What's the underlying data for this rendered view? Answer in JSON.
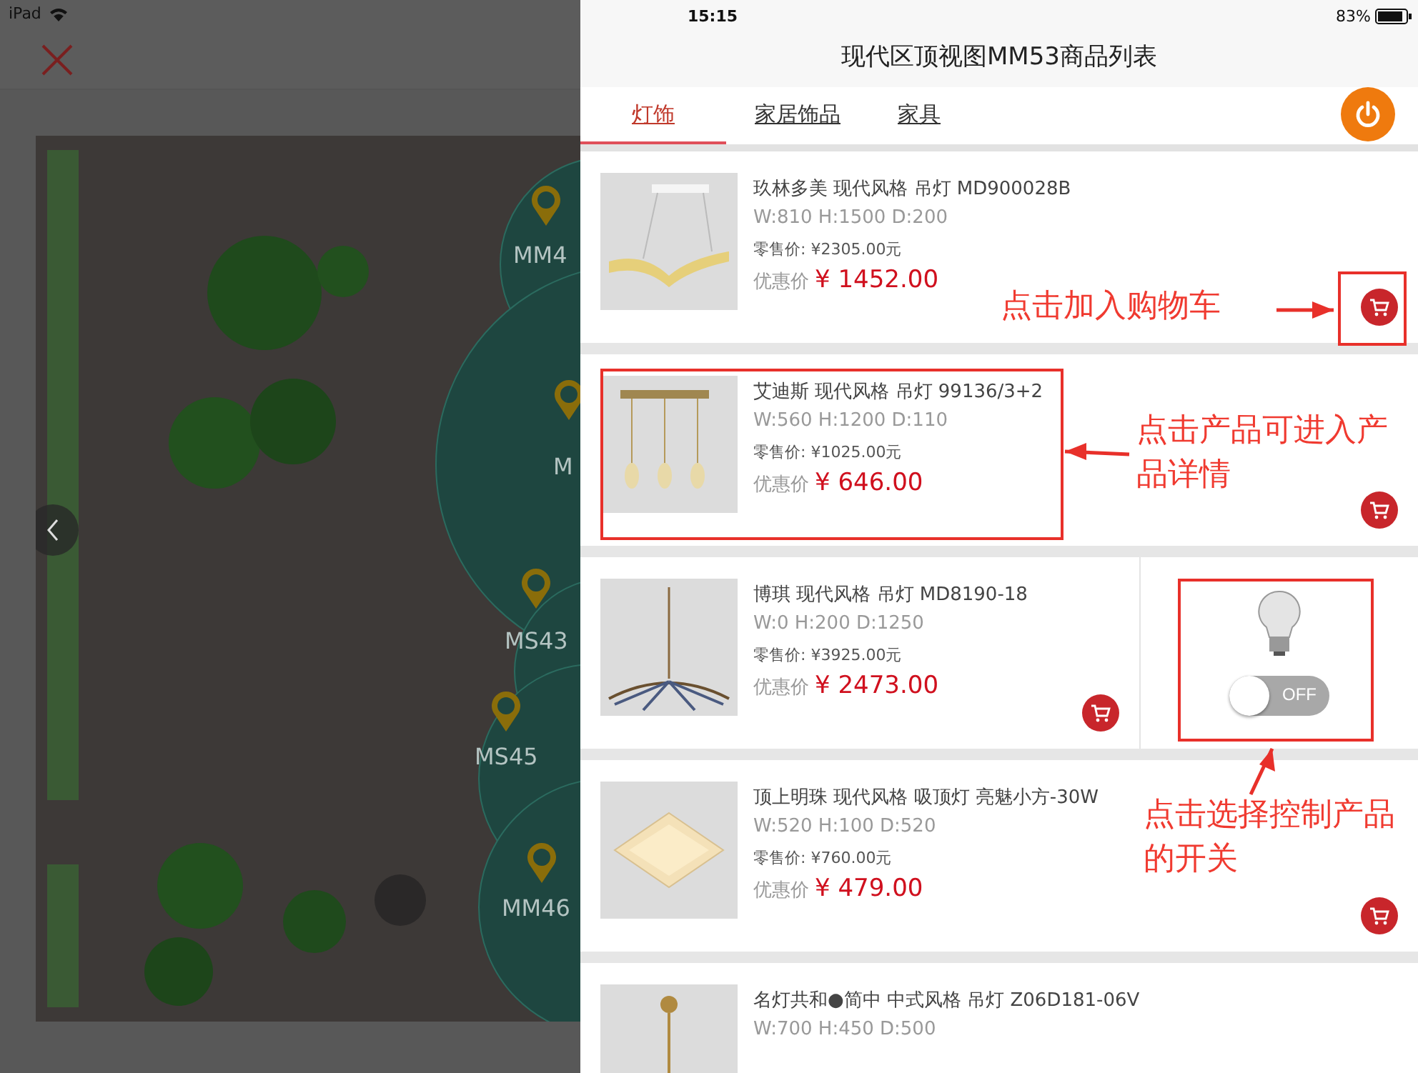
{
  "status_bar": {
    "device": "iPad",
    "time": "15:15",
    "battery": "83%"
  },
  "map": {
    "markers": [
      {
        "label": "MM4"
      },
      {
        "label": "M"
      },
      {
        "label": "MS43"
      },
      {
        "label": "MS45"
      },
      {
        "label": "MM46"
      }
    ]
  },
  "panel": {
    "title": "现代区顶视图MM53商品列表",
    "tabs": [
      {
        "label": "灯饰",
        "selected": true
      },
      {
        "label": "家居饰品",
        "selected": false
      },
      {
        "label": "家具",
        "selected": false
      }
    ],
    "products": [
      {
        "kind": "pendant-wave",
        "name": "玖林多美 现代风格 吊灯 MD900028B",
        "dims": "W:810 H:1500 D:200",
        "retail": "零售价: ¥2305.00元",
        "sale_label": "优惠价",
        "sale_price": "¥ 1452.00"
      },
      {
        "kind": "pendant-triple",
        "name": "艾迪斯 现代风格 吊灯 99136/3+2",
        "dims": "W:560 H:1200 D:110",
        "retail": "零售价: ¥1025.00元",
        "sale_label": "优惠价",
        "sale_price": "¥ 646.00"
      },
      {
        "kind": "chandelier",
        "name": "博琪 现代风格 吊灯 MD8190-18",
        "dims": "W:0 H:200 D:1250",
        "retail": "零售价: ¥3925.00元",
        "sale_label": "优惠价",
        "sale_price": "¥ 2473.00",
        "switch": {
          "label": "OFF",
          "on": false
        }
      },
      {
        "kind": "ceiling",
        "name": "顶上明珠 现代风格 吸顶灯 亮魅小方-30W",
        "dims": "W:520 H:100 D:520",
        "retail": "零售价: ¥760.00元",
        "sale_label": "优惠价",
        "sale_price": "¥ 479.00"
      },
      {
        "kind": "chain",
        "name": "名灯共和●简中 中式风格 吊灯 Z06D181-06V",
        "dims": "W:700 H:450 D:500"
      }
    ]
  },
  "annotations": [
    {
      "kind": "cart",
      "text": "点击加入购物车"
    },
    {
      "kind": "product",
      "text": "点击产品可进入产品详情"
    },
    {
      "kind": "switch",
      "text": "点击选择控制产品的开关"
    }
  ]
}
